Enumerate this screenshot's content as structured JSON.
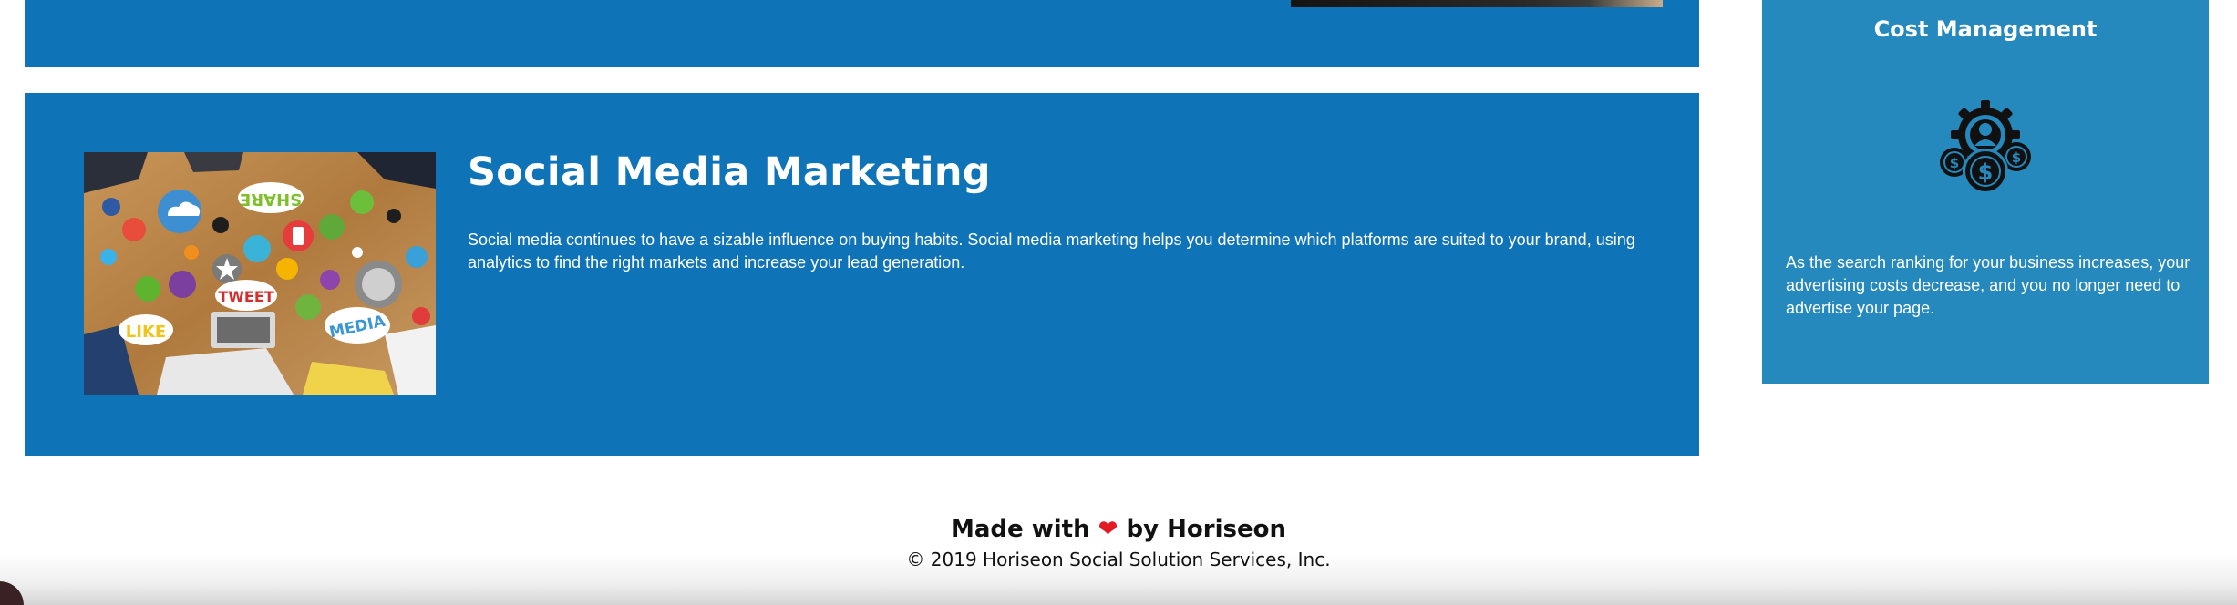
{
  "services": {
    "social_media_marketing": {
      "title": "Social Media Marketing",
      "description": "Social media continues to have a sizable influence on buying habits. Social media marketing helps you determine which platforms are suited to your brand, using analytics to find the right markets and increase your lead generation.",
      "image_words": [
        "SHARE",
        "TWEET",
        "LIKE",
        "MEDIA"
      ]
    }
  },
  "aside": {
    "cost_management": {
      "title": "Cost Management",
      "icon": "cost-management-icon",
      "description": "As the search ranking for your business increases, your advertising costs decrease, and you no longer need to advertise your page."
    }
  },
  "footer": {
    "made_with_prefix": "Made with",
    "heart": "❤",
    "made_with_suffix": "by Horiseon",
    "copyright": "© 2019 Horiseon Social Solution Services, Inc."
  },
  "colors": {
    "panel_blue": "#0f73b8",
    "aside_blue": "#2589bd",
    "heart_red": "#e01b24"
  }
}
